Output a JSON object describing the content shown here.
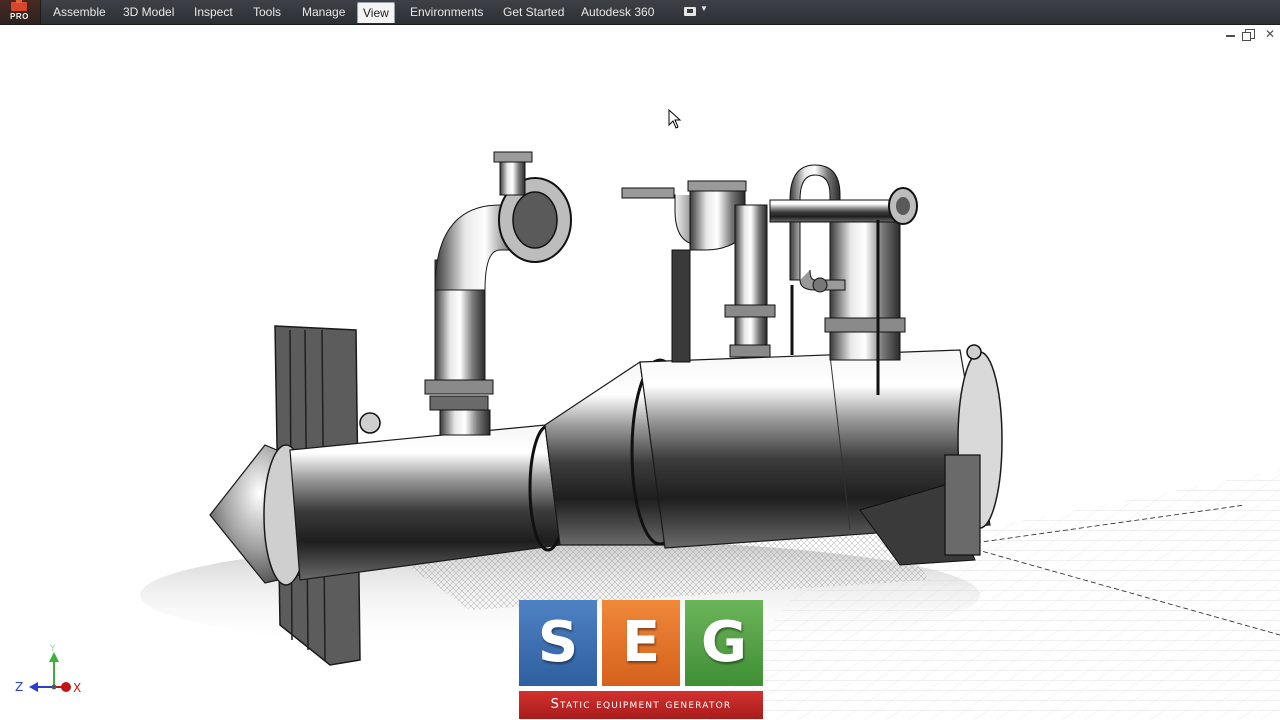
{
  "app": {
    "badge": "PRO"
  },
  "ribbon": {
    "tabs": [
      {
        "label": "Assemble"
      },
      {
        "label": "3D Model"
      },
      {
        "label": "Inspect"
      },
      {
        "label": "Tools"
      },
      {
        "label": "Manage"
      },
      {
        "label": "View",
        "active": true
      },
      {
        "label": "Environments"
      },
      {
        "label": "Get Started"
      },
      {
        "label": "Autodesk 360"
      }
    ]
  },
  "window_controls": [
    "minimize",
    "restore",
    "close"
  ],
  "axes": {
    "y": "Y",
    "z": "Z",
    "x": "X"
  },
  "logo": {
    "letters": [
      "S",
      "E",
      "G"
    ],
    "caption": "Static equipment generator",
    "colors": {
      "s": "#3d71b3",
      "e": "#e8762b",
      "g": "#57a346",
      "bar": "#c52a27"
    }
  },
  "model": {
    "description_icon": "heat-exchanger-3d-model"
  },
  "colors": {
    "menubar": "#33363b",
    "accent_active_tab": "#f4f4f4"
  }
}
